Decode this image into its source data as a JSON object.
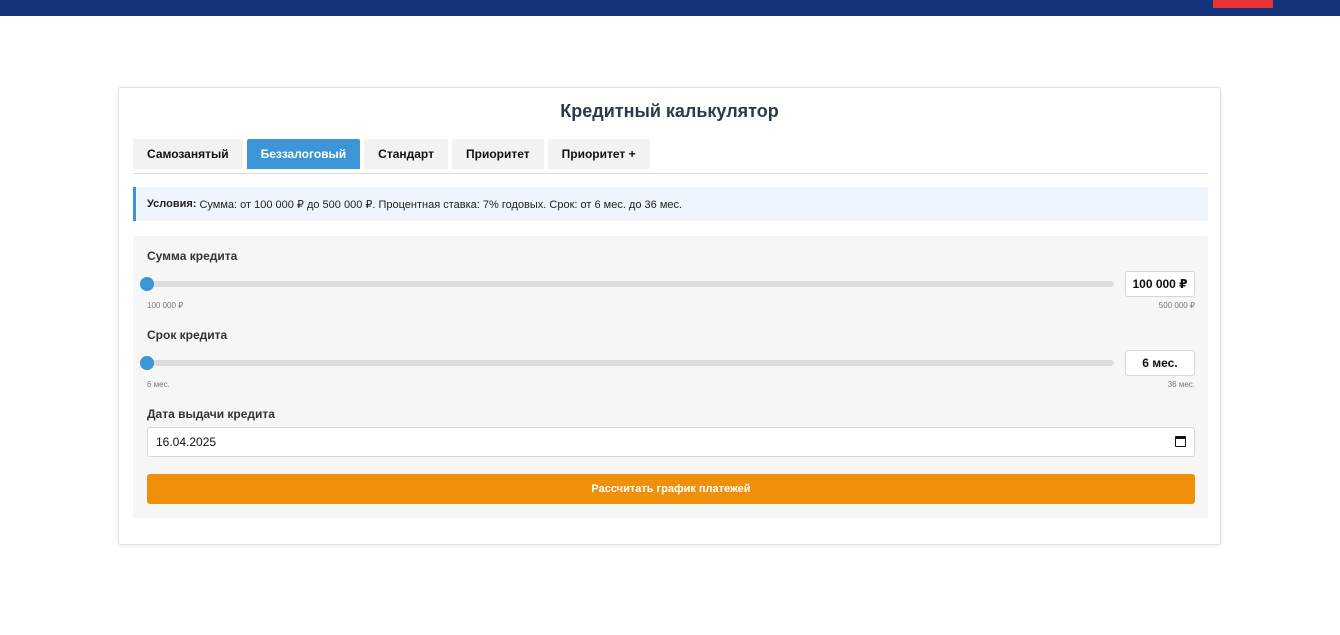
{
  "header": {
    "bar_color": "#14337a",
    "accent_color": "#e8333a"
  },
  "calculator": {
    "title": "Кредитный калькулятор",
    "tabs": [
      {
        "label": "Самозанятый",
        "active": false
      },
      {
        "label": "Беззалоговый",
        "active": true
      },
      {
        "label": "Стандарт",
        "active": false
      },
      {
        "label": "Приоритет",
        "active": false
      },
      {
        "label": "Приоритет +",
        "active": false
      }
    ],
    "conditions": {
      "label": "Условия:",
      "text": "Сумма: от 100 000 ₽ до 500 000 ₽. Процентная ставка: 7% годовых. Срок: от 6 мес. до 36 мес."
    },
    "amount": {
      "label": "Сумма кредита",
      "value_display": "100 000 ₽",
      "min_label": "100 000 ₽",
      "max_label": "500 000 ₽",
      "position_fraction": 0
    },
    "term": {
      "label": "Срок кредита",
      "value_display": "6 мес.",
      "min_label": "6 мес.",
      "max_label": "36 мес.",
      "position_fraction": 0
    },
    "issue_date": {
      "label": "Дата выдачи кредита",
      "value": "16.04.2025"
    },
    "submit_label": "Рассчитать график платежей",
    "colors": {
      "accent": "#3b95d6",
      "button": "#f0900a"
    }
  }
}
